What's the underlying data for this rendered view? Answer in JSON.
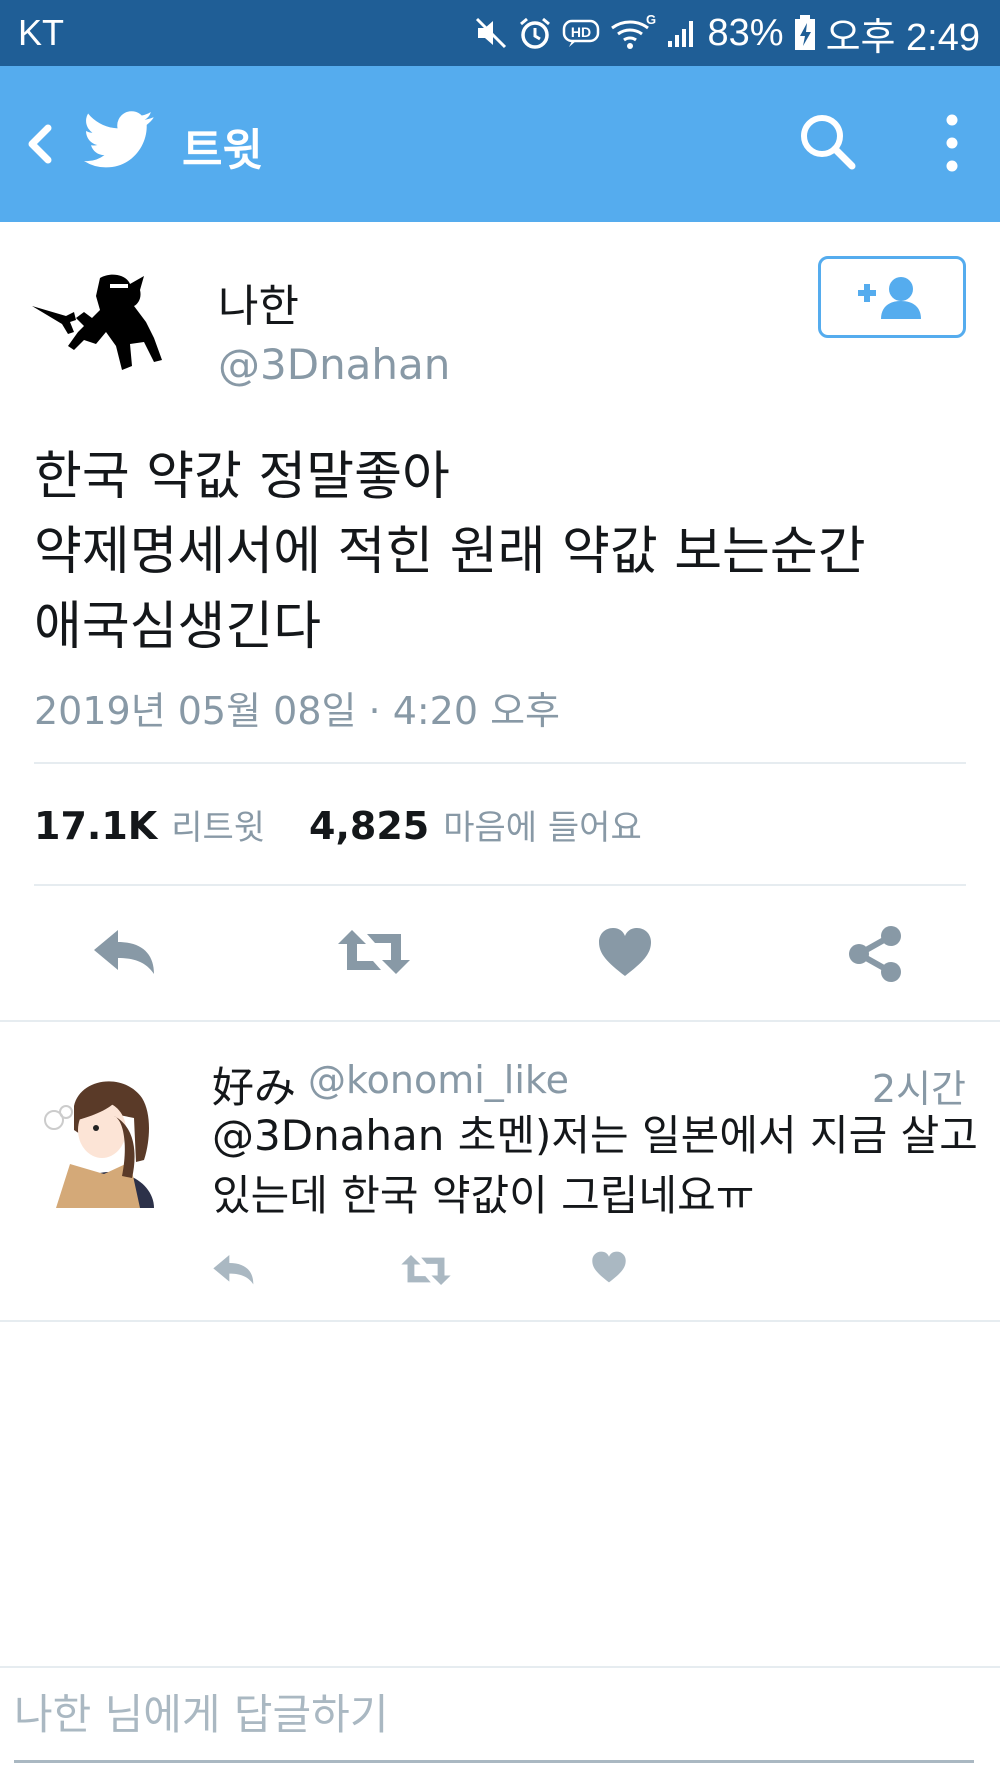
{
  "status_bar": {
    "carrier": "KT",
    "battery": "83%",
    "time": "오후 2:49",
    "network": "G",
    "icons": [
      "mute-icon",
      "alarm-icon",
      "hd-icon",
      "wifi-icon",
      "signal-icon",
      "battery-charging-icon"
    ]
  },
  "app_bar": {
    "title": "트윗",
    "icons": [
      "back-icon",
      "twitter-bird-icon",
      "search-icon",
      "more-vertical-icon"
    ],
    "background": "#55acee"
  },
  "tweet": {
    "display_name": "나한",
    "handle": "@3Dnahan",
    "text_lines": [
      "한국 약값 정말좋아",
      "약제명세서에 적힌 원래 약값 보는순간",
      "애국심생긴다"
    ],
    "timestamp": "2019년 05월 08일 · 4:20 오후",
    "retweets": "17.1K",
    "retweets_label": "리트윗",
    "likes": "4,825",
    "likes_label": "마음에 들어요",
    "action_icons": [
      "reply-icon",
      "retweet-icon",
      "heart-icon",
      "share-icon"
    ]
  },
  "reply": {
    "display_name": "好み",
    "handle": "@konomi_like",
    "time": "2시간",
    "text_lines": [
      "@3Dnahan 초멘)저는 일본에서 지금 살고",
      "있는데 한국 약값이 그립네요ㅠ"
    ]
  },
  "compose": {
    "placeholder": "나한 님에게 답글하기"
  },
  "colors": {
    "status_bar": "#1f5e96",
    "accent": "#55acee",
    "icon_gray": "#8899a6"
  }
}
